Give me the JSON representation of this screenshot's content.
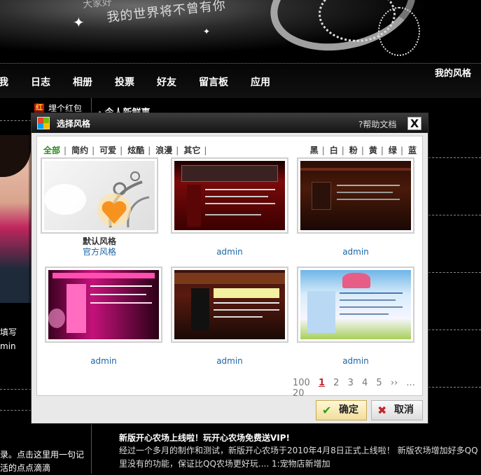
{
  "banner": {
    "slogan_top": "大家好",
    "slogan": "我的世界将不曾有你"
  },
  "nav": {
    "items": [
      "我",
      "日志",
      "相册",
      "投票",
      "好友",
      "留言板",
      "应用"
    ],
    "right_label": "我的风格"
  },
  "left": {
    "red_badge": "红",
    "red_text": "埋个红包",
    "frag1": "填写",
    "frag2": "min",
    "news_lines": [
      "录。点击这里用一句记",
      "活的点点滴滴"
    ]
  },
  "content": {
    "title": "· 今人新鲜事",
    "news_title": "新版开心农场上线啦！玩开心农场免费送VIP!",
    "news_lines": [
      "经过一个多月的制作和测试，新版开心农场于2010年4月8日正式上线啦！ 新版农场增加好多QQ",
      "里没有的功能，保证比QQ农场更好玩.... 1:宠物店新增加"
    ]
  },
  "dialog": {
    "title": "选择风格",
    "help": "?帮助文档",
    "close": "X",
    "filters": [
      "全部",
      "简约",
      "可爱",
      "炫酷",
      "浪漫",
      "其它"
    ],
    "colors": [
      "黑",
      "白",
      "粉",
      "黄",
      "绿",
      "蓝"
    ],
    "themes": [
      {
        "name": "默认风格",
        "author": "官方风格"
      },
      {
        "author": "admin"
      },
      {
        "author": "admin"
      },
      {
        "author": "admin"
      },
      {
        "author": "admin"
      },
      {
        "author": "admin"
      }
    ],
    "pager": {
      "first": "100",
      "pages": [
        "1",
        "2",
        "3",
        "4",
        "5"
      ],
      "current": "1",
      "next": "››",
      "last": "... 20"
    },
    "ok_label": "确定",
    "cancel_label": "取消"
  },
  "colors": {
    "active_filter": "#2f8a1d",
    "link": "#1a65a6",
    "pager_current": "#c0262d"
  }
}
